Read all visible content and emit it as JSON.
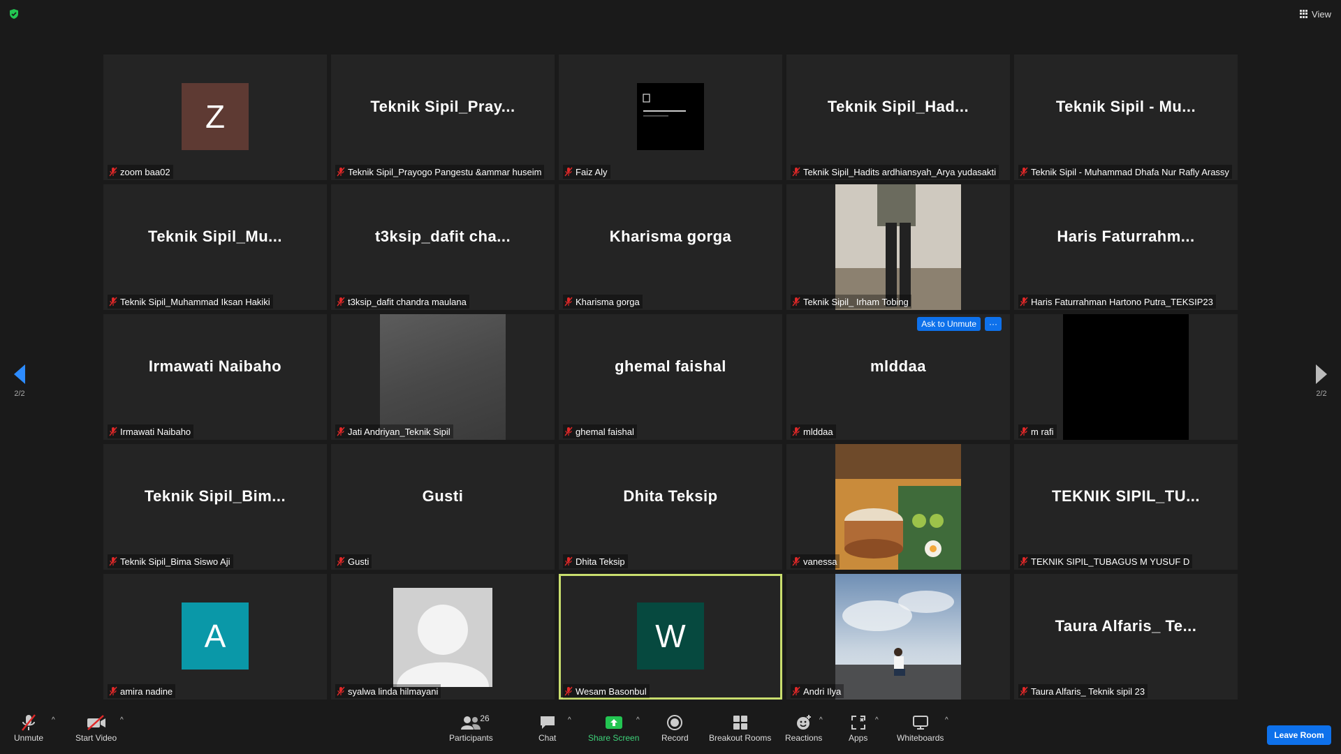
{
  "topbar": {
    "view_label": "View"
  },
  "pager": {
    "left_label": "2/2",
    "right_label": "2/2"
  },
  "tiles": [
    {
      "big": "",
      "label": "zoom baa02",
      "avatar": "Z",
      "avatar_color": "#5e3a33"
    },
    {
      "big": "Teknik  Sipil_Pray...",
      "label": "Teknik Sipil_Prayogo Pangestu &ammar huseim"
    },
    {
      "big": "",
      "label": "Faiz Aly",
      "video": "dark-doc"
    },
    {
      "big": "Teknik  Sipil_Had...",
      "label": "Teknik Sipil_Hadits ardhiansyah_Arya yudasakti"
    },
    {
      "big": "Teknik  Sipil  -  Mu...",
      "label": "Teknik Sipil - Muhammad Dhafa Nur Rafly Arassy"
    },
    {
      "big": "Teknik  Sipil_Mu...",
      "label": "Teknik Sipil_Muhammad Iksan Hakiki"
    },
    {
      "big": "t3ksip_dafit  cha...",
      "label": "t3ksip_dafit chandra maulana"
    },
    {
      "big": "Kharisma  gorga",
      "label": "Kharisma gorga"
    },
    {
      "big": "",
      "label": "Teknik Sipil_ Irham Tobing",
      "video": "person"
    },
    {
      "big": "Haris  Faturrahm...",
      "label": "Haris Faturrahman Hartono Putra_TEKSIP23"
    },
    {
      "big": "Irmawati  Naibaho",
      "label": "Irmawati Naibaho"
    },
    {
      "big": "",
      "label": "Jati Andriyan_Teknik Sipil",
      "video": "grey"
    },
    {
      "big": "ghemal  faishal",
      "label": "ghemal faishal"
    },
    {
      "big": "mlddaa",
      "label": "mlddaa",
      "ask_unmute": "Ask to Unmute",
      "more": "···"
    },
    {
      "big": "",
      "label": "m rafi",
      "video": "black"
    },
    {
      "big": "Teknik  Sipil_Bim...",
      "label": "Teknik Sipil_Bima Siswo Aji"
    },
    {
      "big": "Gusti",
      "label": "Gusti"
    },
    {
      "big": "Dhita  Teksip",
      "label": "Dhita Teksip"
    },
    {
      "big": "",
      "label": "vanessa",
      "video": "food"
    },
    {
      "big": "TEKNIK  SIPIL_TU...",
      "label": "TEKNIK SIPIL_TUBAGUS M YUSUF D"
    },
    {
      "big": "",
      "label": "amira nadine",
      "avatar": "A",
      "avatar_color": "#0a98a8"
    },
    {
      "big": "",
      "label": "syalwa linda hilmayani",
      "video": "default-avatar"
    },
    {
      "big": "",
      "label": "Wesam Basonbul",
      "avatar": "W",
      "avatar_color": "#06493f",
      "active": true
    },
    {
      "big": "",
      "label": "Andri Ilya",
      "video": "sky"
    },
    {
      "big": "Taura  Alfaris_  Te...",
      "label": "Taura Alfaris_ Teknik sipil 23"
    }
  ],
  "toolbar": {
    "unmute": "Unmute",
    "start_video": "Start Video",
    "participants": "Participants",
    "participant_count": "26",
    "chat": "Chat",
    "share_screen": "Share Screen",
    "record": "Record",
    "breakout_rooms": "Breakout Rooms",
    "reactions": "Reactions",
    "apps": "Apps",
    "whiteboards": "Whiteboards",
    "leave_room": "Leave Room"
  },
  "colors": {
    "accent": "#0e71eb",
    "active_speaker": "#c9de6e",
    "share_green": "#3ed37a",
    "mute_red": "#e02828"
  }
}
